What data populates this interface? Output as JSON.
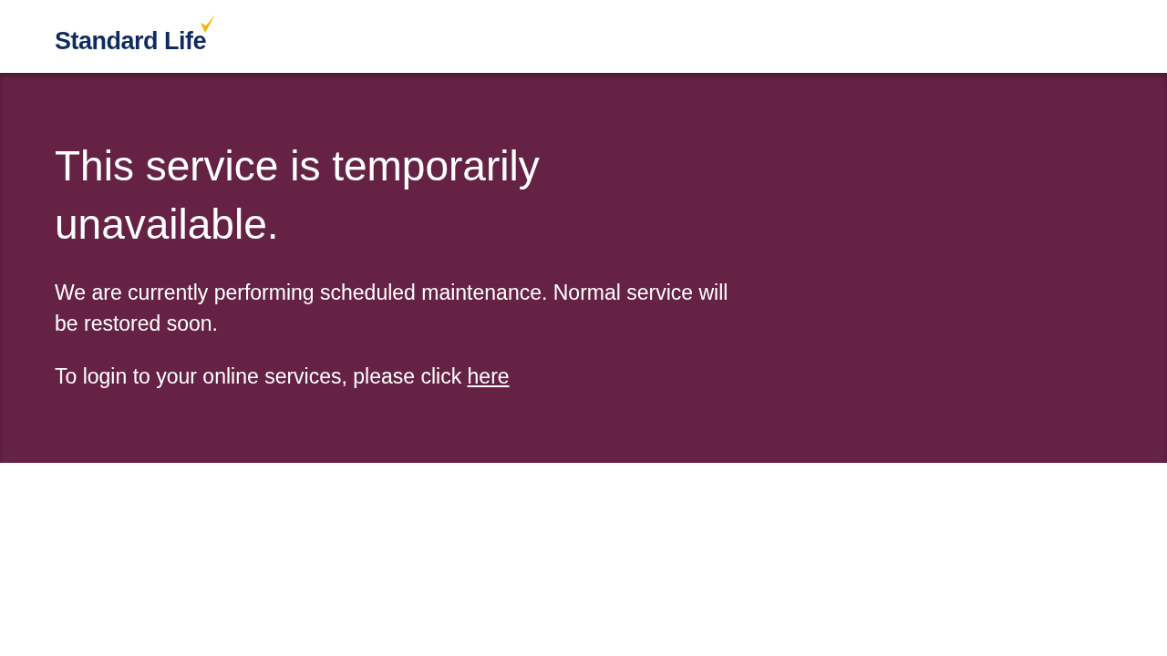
{
  "header": {
    "logo": "Standard Life"
  },
  "notice": {
    "title": "This service is temporarily unavailable.",
    "message": "We are currently performing scheduled maintenance. Normal service will be restored soon.",
    "login_prompt": {
      "text": "To login to your online services, please click",
      "link": "here"
    }
  }
}
